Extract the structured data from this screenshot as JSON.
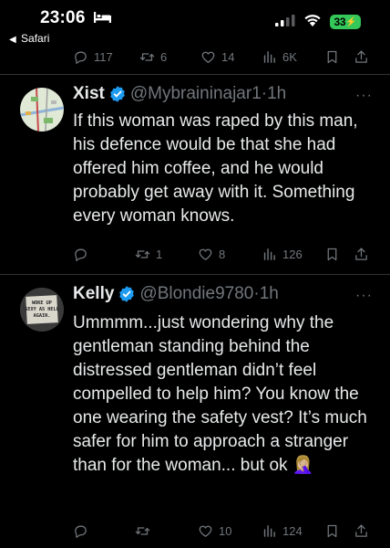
{
  "status_bar": {
    "time": "23:06",
    "back_app": "Safari",
    "battery": "33",
    "battery_color": "#34c759"
  },
  "top_actions": {
    "replies": "117",
    "retweets": "6",
    "likes": "14",
    "views": "6K"
  },
  "tweets": [
    {
      "name": "Xist",
      "handle": "@Mybraininajar1",
      "time": "1h",
      "text": "If this woman was raped by this man, his defence would be that she had offered him coffee, and he would probably get away with it. Something every woman knows.",
      "replies": "",
      "retweets": "1",
      "likes": "8",
      "views": "126"
    },
    {
      "name": "Kelly",
      "handle": "@Blondie9780",
      "time": "1h",
      "text": "Ummmm...just wondering why the gentleman standing behind the distressed gentleman didn’t feel compelled to help him? You know the one wearing the safety vest? It’s much safer for him to approach a stranger than for the woman... but ok 🤦🏼‍♀️",
      "avatar_text": "WOKE UP SEXY AS HELL AGAIN.",
      "replies": "",
      "retweets": "",
      "likes": "10",
      "views": "124"
    }
  ],
  "colors": {
    "background": "#000000",
    "text": "#e7e9ea",
    "muted": "#71767b",
    "verified": "#1d9bf0",
    "divider": "#2f3336"
  }
}
